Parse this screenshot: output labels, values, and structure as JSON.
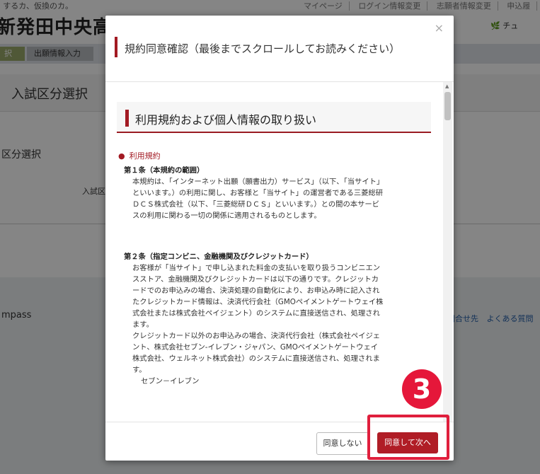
{
  "background": {
    "tagline": "a するカ、仮換のカ。",
    "school_name": "新発田中央高",
    "top_links": [
      "マイページ",
      "ログイン情報変更",
      "志願者情報変更",
      "申込履"
    ],
    "chat_label": "チュ",
    "steps": [
      "択",
      "出願情報入力"
    ],
    "section_title": "入試区分選択",
    "label_1": "区分選択",
    "label_2": "入試区",
    "footer_brand": "mpass",
    "footer_links": [
      "問合せ先",
      "よくある質問"
    ]
  },
  "modal": {
    "close_glyph": "×",
    "title": "規約同意確認（最後までスクロールしてお読みください）",
    "section_heading": "利用規約および個人情報の取り扱い",
    "sub_heading": "利用規約",
    "sub_bullet": "●",
    "article1_heading": "第１条（本規約の範囲）",
    "article1_body": "本規約は、「インターネット出願（願書出力）サービス」（以下、「当サイト」といいます。）の利用に関し、お客様と「当サイト」の運営者である三菱総研ＤＣＳ株式会社（以下、「三菱総研ＤＣＳ」といいます。）との間の本サービスの利用に関わる一切の関係に適用されるものとします。",
    "article2_heading": "第２条（指定コンビニ、金融機関及びクレジットカード）",
    "article2_body": "お客様が「当サイト」で申し込まれた料金の支払いを取り扱うコンビニエンスストア、金融機関及びクレジットカードは以下の通りです。クレジットカードでのお申込みの場合、決済処理の自動化により、お申込み時に記入されたクレジットカード情報は、決済代行会社（GMOペイメントゲートウェイ株式会社または株式会社ペイジェント）のシステムに直接送信され、処理されます。",
    "article2_body_2": "クレジットカード以外のお申込みの場合、決済代行会社（株式会社ペイジェント、株式会社セブン‐イレブン・ジャパン、GMOペイメントゲートウェイ株式会社、ウェルネット株式会社）のシステムに直接送信され、処理されます。",
    "article2_item": "セブン－イレブン",
    "disagree_label": "同意しない",
    "agree_label": "同意して次へ"
  },
  "callout": {
    "number": "3",
    "highlight_color": "#e01f3d"
  },
  "colors": {
    "accent": "#a21a23",
    "agree_button": "#b01d26"
  }
}
